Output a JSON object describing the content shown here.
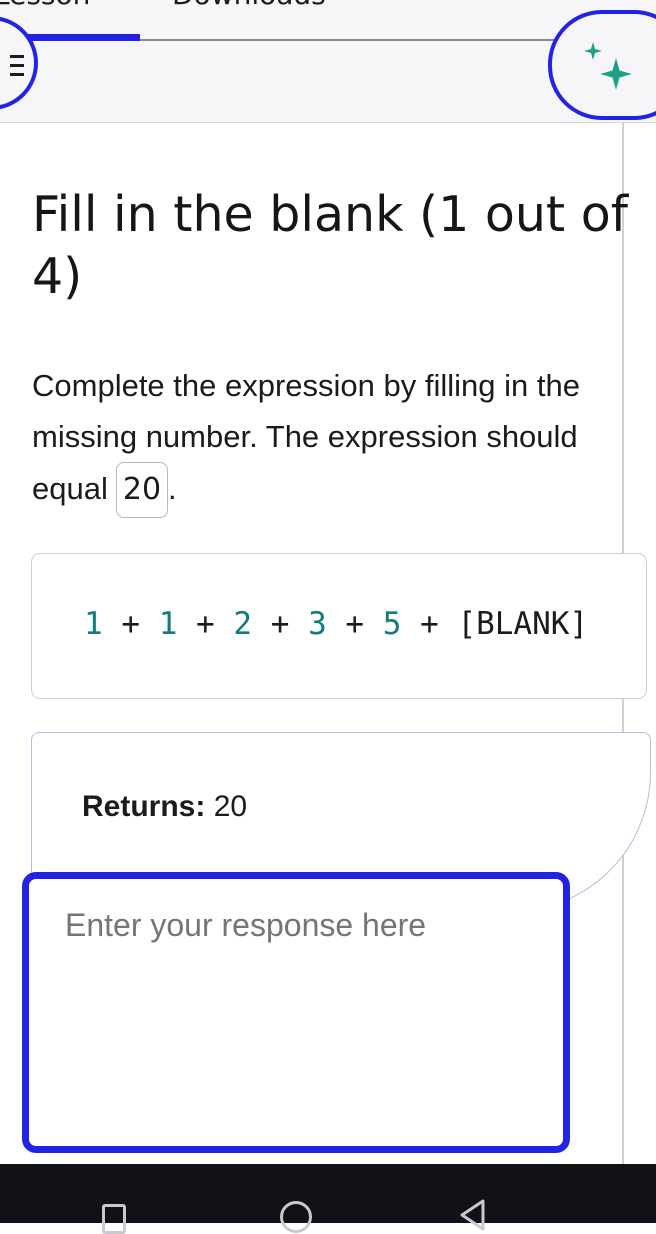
{
  "header": {
    "tabs": [
      {
        "label": "Lesson",
        "active": true
      },
      {
        "label": "Downloads",
        "active": false
      }
    ],
    "menu_icon": "menu-icon",
    "ai_icon": "sparkle-icon",
    "accent_color": "#2323e6"
  },
  "question": {
    "title": "Fill in the blank (1 out of 4)",
    "prompt": "Complete the expression by filling in the missing number. The expression should equal",
    "target_value": "20",
    "period": "."
  },
  "expression": {
    "tokens": [
      {
        "text": "1",
        "type": "number"
      },
      {
        "text": "+",
        "type": "operator"
      },
      {
        "text": "1",
        "type": "number"
      },
      {
        "text": "+",
        "type": "operator"
      },
      {
        "text": "2",
        "type": "number"
      },
      {
        "text": "+",
        "type": "operator"
      },
      {
        "text": "3",
        "type": "number"
      },
      {
        "text": "+",
        "type": "operator"
      },
      {
        "text": "5",
        "type": "number"
      },
      {
        "text": "+",
        "type": "operator"
      },
      {
        "text": "[BLANK]",
        "type": "blank"
      }
    ]
  },
  "returns": {
    "label": "Returns:",
    "value": "20"
  },
  "response": {
    "value": "",
    "placeholder": "Enter your response here"
  },
  "system_nav": {
    "recents_icon": "recents-icon",
    "home_icon": "home-icon",
    "back_icon": "back-icon"
  }
}
